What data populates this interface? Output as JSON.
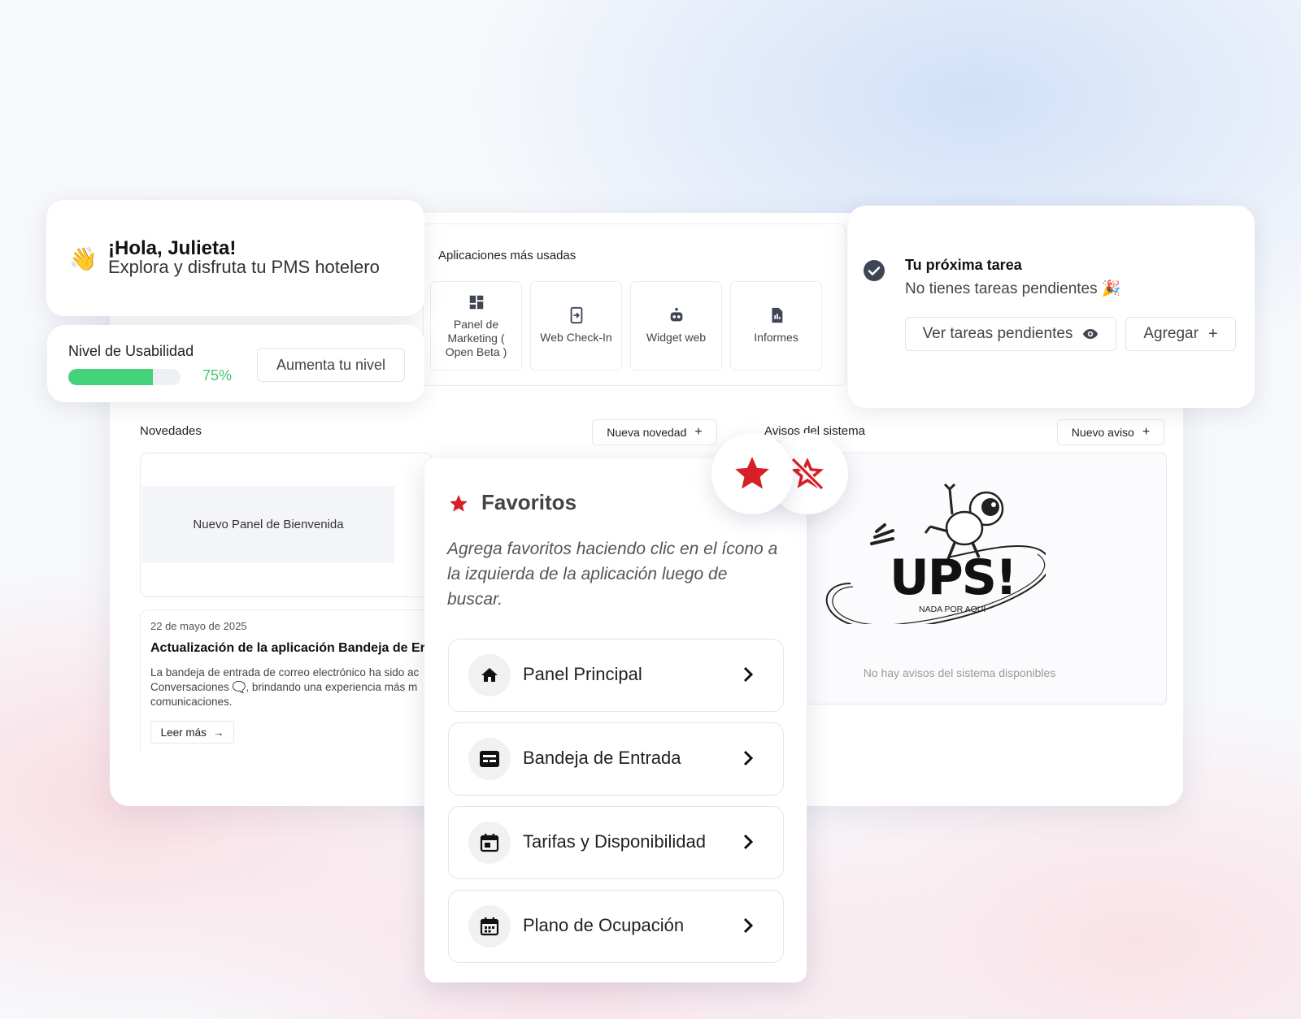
{
  "greeting": {
    "wave_emoji": "👋",
    "hello": "¡Hola, Julieta!",
    "subtitle": "Explora y disfruta tu PMS hotelero"
  },
  "usability": {
    "title": "Nivel de Usabilidad",
    "progress": 0.75,
    "percent_label": "75%",
    "button_label": "Aumenta tu nivel",
    "progress_color": "#44d27a"
  },
  "apps": {
    "title": "Aplicaciones más usadas",
    "items": [
      {
        "label": "Panel de Marketing ( Open Beta )",
        "icon": "dashboard-icon"
      },
      {
        "label": "Web Check-In",
        "icon": "phone-login-icon"
      },
      {
        "label": "Widget web",
        "icon": "robot-icon"
      },
      {
        "label": "Informes",
        "icon": "report-icon"
      }
    ]
  },
  "task": {
    "title": "Tu próxima tarea",
    "subtitle": "No tienes tareas pendientes 🎉",
    "view_button": "Ver tareas pendientes",
    "add_button": "Agregar"
  },
  "news": {
    "title": "Novedades",
    "new_button": "Nueva novedad",
    "banner_label": "Nuevo Panel de Bienvenida",
    "article": {
      "date": "22 de mayo de 2025",
      "headline": "Actualización de la aplicación Bandeja de Er",
      "body_line1": "La bandeja de entrada de correo electrónico ha sido ac",
      "body_line2": "Conversaciones 🗨️, brindando una experiencia más m",
      "body_line3": "comunicaciones.",
      "read_more": "Leer más"
    }
  },
  "notices": {
    "title": "Avisos del sistema",
    "new_button": "Nuevo aviso",
    "illustration_text": "UPS!",
    "illustration_caption": "NADA POR AQUÍ",
    "empty_text": "No hay avisos del sistema disponibles"
  },
  "favorites": {
    "title": "Favoritos",
    "description": "Agrega favoritos haciendo clic en el ícono a la izquierda de la aplicación luego de buscar.",
    "items": [
      {
        "label": "Panel Principal",
        "icon": "home-icon"
      },
      {
        "label": "Bandeja de Entrada",
        "icon": "inbox-icon"
      },
      {
        "label": "Tarifas y Disponibilidad",
        "icon": "calendar-icon"
      },
      {
        "label": "Plano de Ocupación",
        "icon": "calendar-grid-icon"
      }
    ],
    "accent_color": "#d61f26"
  }
}
